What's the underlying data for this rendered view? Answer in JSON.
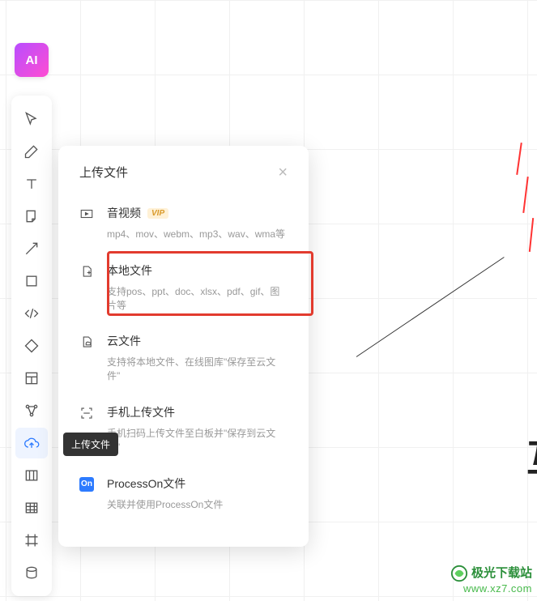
{
  "ai_button": {
    "label": "AI"
  },
  "tooltip": "上传文件",
  "popup": {
    "title": "上传文件",
    "items": [
      {
        "title": "音视频",
        "vip": "VIP",
        "sub": "mp4、mov、webm、mp3、wav、wma等"
      },
      {
        "title": "本地文件",
        "sub": "支持pos、ppt、doc、xlsx、pdf、gif、图片等"
      },
      {
        "title": "云文件",
        "sub": "支持将本地文件、在线图库\"保存至云文件\""
      },
      {
        "title": "手机上传文件",
        "sub": "手机扫码上传文件至白板并\"保存到云文件\""
      },
      {
        "title": "ProcessOn文件",
        "sub": "关联并使用ProcessOn文件",
        "badge": "On"
      }
    ]
  },
  "canvas": {
    "partial_char": "互"
  },
  "watermark": {
    "line1": "极光下载站",
    "line2": "www.xz7.com"
  }
}
